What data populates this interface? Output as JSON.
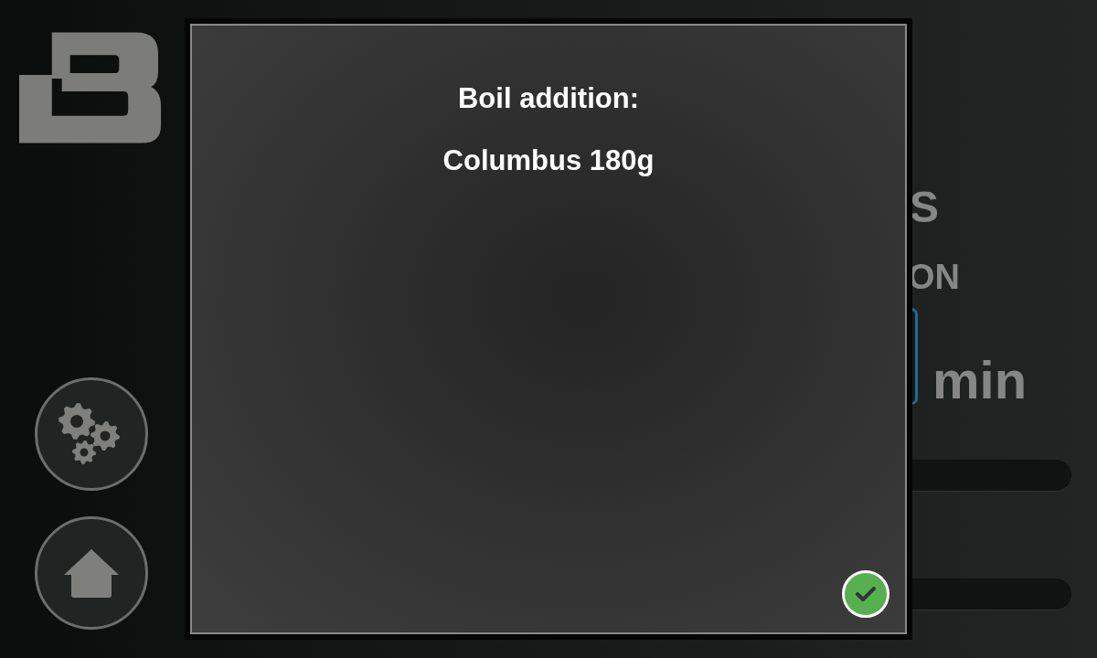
{
  "sidebar": {
    "buttons": [
      {
        "kind": "settings"
      },
      {
        "kind": "home"
      }
    ]
  },
  "background": {
    "heading": "S",
    "label": "ON",
    "unit": "min"
  },
  "dialog": {
    "lines": [
      "Boil addition:",
      "Columbus 180g"
    ],
    "confirm": {
      "kind": "check"
    }
  }
}
